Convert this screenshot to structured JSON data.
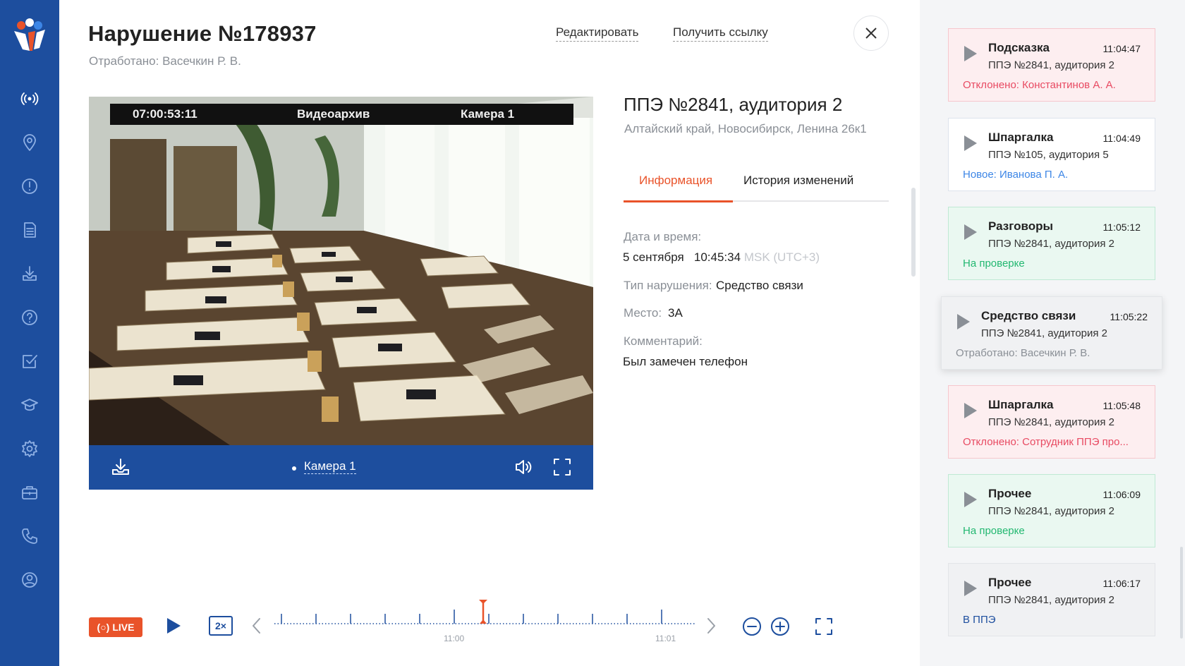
{
  "header": {
    "title": "Нарушение №178937",
    "subtitle": "Отработано: Васечкин Р. В.",
    "edit_label": "Редактировать",
    "link_label": "Получить ссылку"
  },
  "video": {
    "timestamp": "07:00:53:11",
    "source": "Видеоархив",
    "camera_overlay": "Камера 1",
    "camera_label": "Камера 1"
  },
  "info": {
    "ppe_title": "ППЭ №2841, аудитория 2",
    "address": "Алтайский край, Новосибирск, Ленина 26к1",
    "tabs": [
      {
        "label": "Информация",
        "active": true
      },
      {
        "label": "История изменений",
        "active": false
      }
    ],
    "datetime_label": "Дата и время:",
    "date_value": "5 сентября",
    "time_value": "10:45:34",
    "timezone": "MSK (UTC+3)",
    "type_label": "Тип нарушения:",
    "type_value": "Средство связи",
    "place_label": "Место:",
    "place_value": "3А",
    "comment_label": "Комментарий:",
    "comment_value": "Был замечен телефон"
  },
  "timeline": {
    "live_label": "LIVE",
    "speed_label": "2×",
    "tick_labels": [
      "11:00",
      "11:01"
    ]
  },
  "events": [
    {
      "title": "Подсказка",
      "time": "11:04:47",
      "ppe": "ППЭ №2841, аудитория 2",
      "status": "Отклонено: Константинов А. А.",
      "style": "red"
    },
    {
      "title": "Шпаргалка",
      "time": "11:04:49",
      "ppe": "ППЭ №105, аудитория 5",
      "status": "Новое: Иванова П. А.",
      "style": "blue"
    },
    {
      "title": "Разговоры",
      "time": "11:05:12",
      "ppe": "ППЭ №2841, аудитория 2",
      "status": "На проверке",
      "style": "green"
    },
    {
      "title": "Средство связи",
      "time": "11:05:22",
      "ppe": "ППЭ №2841, аудитория 2",
      "status": "Отработано: Васечкин Р. В.",
      "style": "gray"
    },
    {
      "title": "Шпаргалка",
      "time": "11:05:48",
      "ppe": "ППЭ №2841, аудитория 2",
      "status": "Отклонено: Сотрудник ППЭ про...",
      "style": "red"
    },
    {
      "title": "Прочее",
      "time": "11:06:09",
      "ppe": "ППЭ №2841, аудитория 2",
      "status": "На проверке",
      "style": "green"
    },
    {
      "title": "Прочее",
      "time": "11:06:17",
      "ppe": "ППЭ №2841, аудитория 2",
      "status": "В ППЭ",
      "style": "gray"
    }
  ],
  "colors": {
    "sidebar": "#1d4e9e",
    "accent": "#e9532a",
    "status_red": "#e84a62",
    "status_green": "#23b871",
    "status_blue": "#3d86e6"
  }
}
